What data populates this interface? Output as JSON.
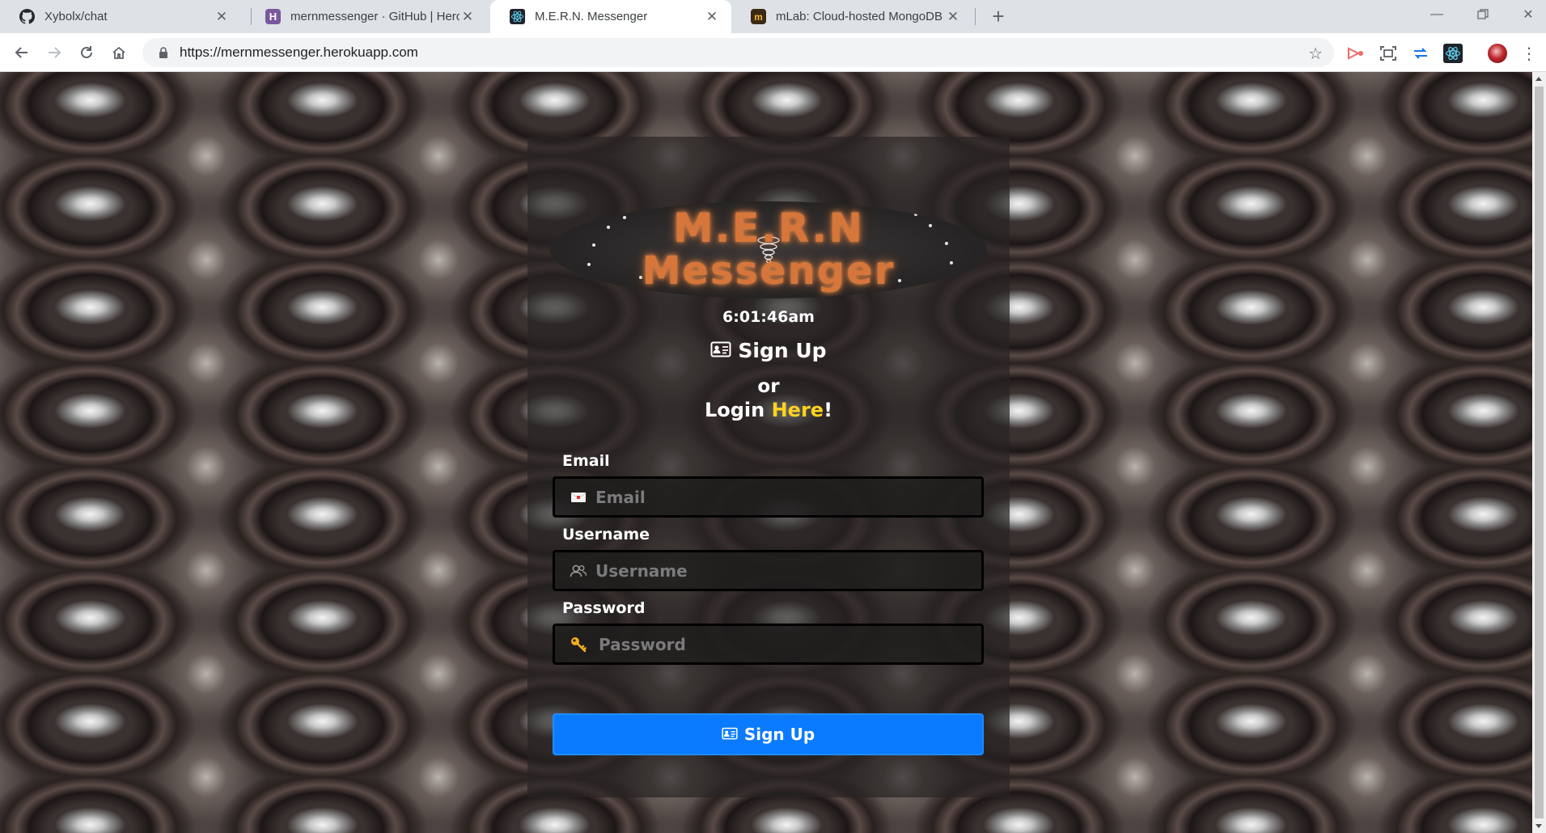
{
  "browser": {
    "tabs": [
      {
        "title": "Xybolx/chat",
        "icon": "github-icon",
        "active": false
      },
      {
        "title": "mernmessenger · GitHub | Herok",
        "icon": "heroku-icon",
        "active": false
      },
      {
        "title": "M.E.R.N. Messenger",
        "icon": "react-icon",
        "active": true
      },
      {
        "title": "mLab: Cloud-hosted MongoDB",
        "icon": "mlab-icon",
        "active": false
      }
    ],
    "url": "https://mernmessenger.herokuapp.com",
    "extensions": [
      "cast-icon",
      "screenshot-icon",
      "arrows-icon",
      "react-devtools-icon",
      "profile-avatar-icon"
    ]
  },
  "page": {
    "logo": {
      "line1": "M.E.R.N",
      "line2": "Messenger"
    },
    "clock": "6:01:46am",
    "heading": "Sign Up",
    "or_text": "or",
    "login_prefix": "Login ",
    "login_link": "Here",
    "login_suffix": "!",
    "form": {
      "email_label": "Email",
      "email_placeholder": "Email",
      "username_label": "Username",
      "username_placeholder": "Username",
      "password_label": "Password",
      "password_placeholder": "Password",
      "submit_label": "Sign Up"
    }
  },
  "colors": {
    "accent_blue": "#0a7bff",
    "logo_orange": "#d6763a",
    "link_yellow": "#ffd21f"
  }
}
